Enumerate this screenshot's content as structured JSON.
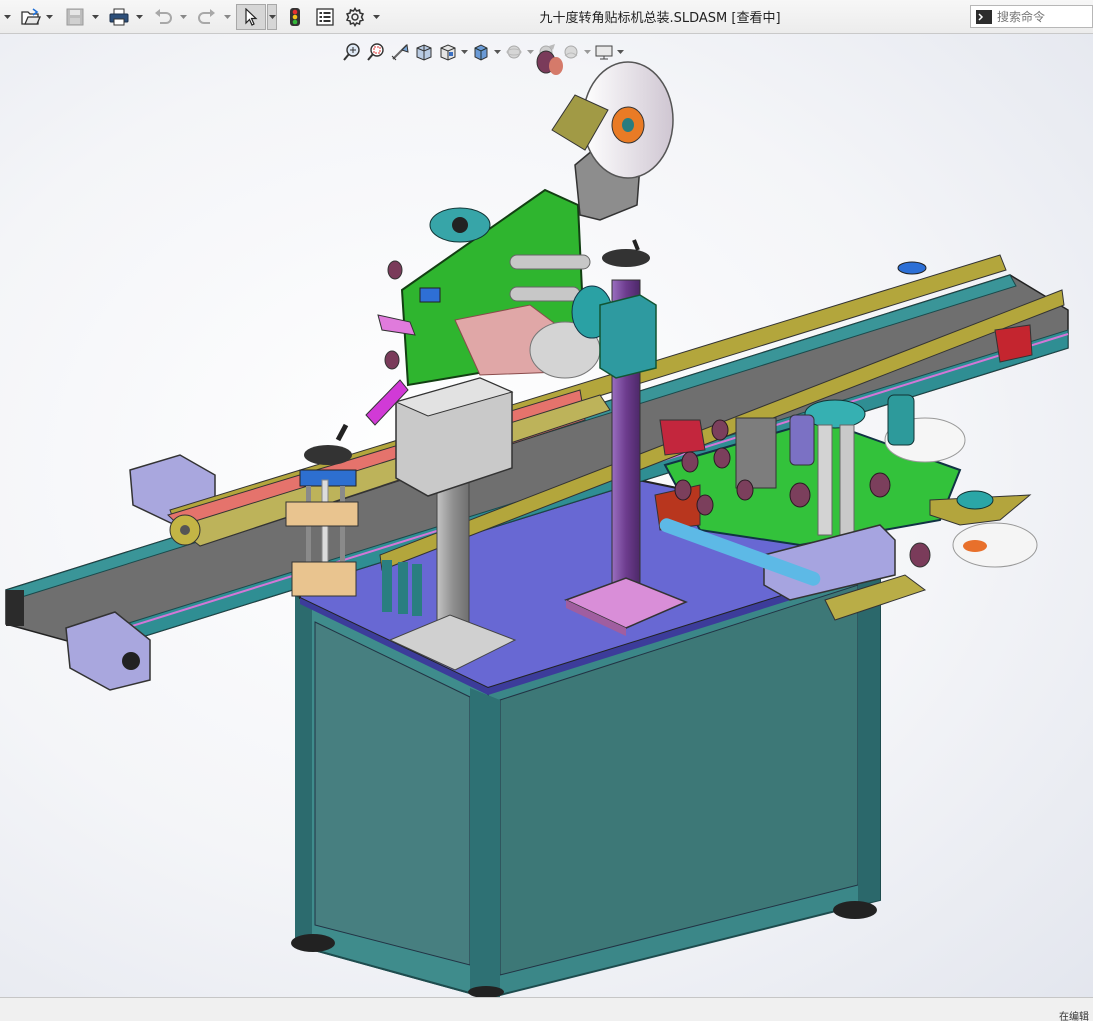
{
  "window": {
    "title": "九十度转角贴标机总装.SLDASM [查看中]"
  },
  "toolbar": {
    "items": [
      {
        "name": "open-button",
        "icon": "open-folder-icon"
      },
      {
        "name": "save-button",
        "icon": "save-disk-icon"
      },
      {
        "name": "print-button",
        "icon": "printer-icon"
      },
      {
        "name": "undo-button",
        "icon": "undo-arrow-icon"
      },
      {
        "name": "redo-button",
        "icon": "redo-arrow-icon"
      },
      {
        "name": "select-button",
        "icon": "cursor-arrow-icon",
        "active": true
      },
      {
        "name": "rebuild-button",
        "icon": "traffic-light-icon"
      },
      {
        "name": "file-properties-button",
        "icon": "properties-list-icon"
      },
      {
        "name": "options-button",
        "icon": "gear-icon"
      }
    ]
  },
  "search": {
    "placeholder": "搜索命令",
    "icon": "command-prompt-icon"
  },
  "heads_up_toolbar": {
    "items": [
      "zoom-to-fit-icon",
      "zoom-to-area-icon",
      "previous-view-icon",
      "section-view-icon",
      "view-orientation-icon",
      "display-style-icon",
      "hide-show-icon",
      "edit-appearance-icon",
      "apply-scene-icon",
      "view-settings-icon"
    ]
  },
  "viewport": {
    "content": "九十度转角贴标机 3D 装配体模型",
    "colors": {
      "frame": "#3f8b8c",
      "frame_dark": "#2b6f72",
      "table_top": "#6a6ad8",
      "conveyor_rail": "#2f8e93",
      "guide_rail": "#b2a43a",
      "bracket_green": "#2fb52f",
      "column": "#7c4aa0",
      "pink_plate": "#d77fd6",
      "belt": "#6b6b6b"
    }
  },
  "statusbar": {
    "text": "在编辑"
  }
}
